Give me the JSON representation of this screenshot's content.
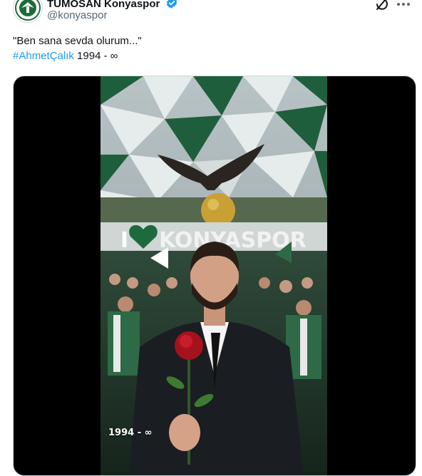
{
  "account": {
    "display_name": "TÜMOSAN Konyaspor",
    "handle": "@konyaspor"
  },
  "post": {
    "text_line1": "\"Ben sana sevda olurum...\"",
    "hashtag": "#AhmetÇalık",
    "years": "1994 - ∞"
  },
  "media": {
    "banner_text": "KONYASPOR",
    "banner_prefix": "I",
    "overlay_text": "1994 - ∞"
  },
  "icons": [
    "verified-badge-icon",
    "grok-icon",
    "more-icon",
    "heart-icon",
    "eagle-statue",
    "rose"
  ],
  "colors": {
    "hashtag": "#1d9bf0",
    "club_green": "#1d6b3c",
    "verified": "#1d9bf0"
  }
}
